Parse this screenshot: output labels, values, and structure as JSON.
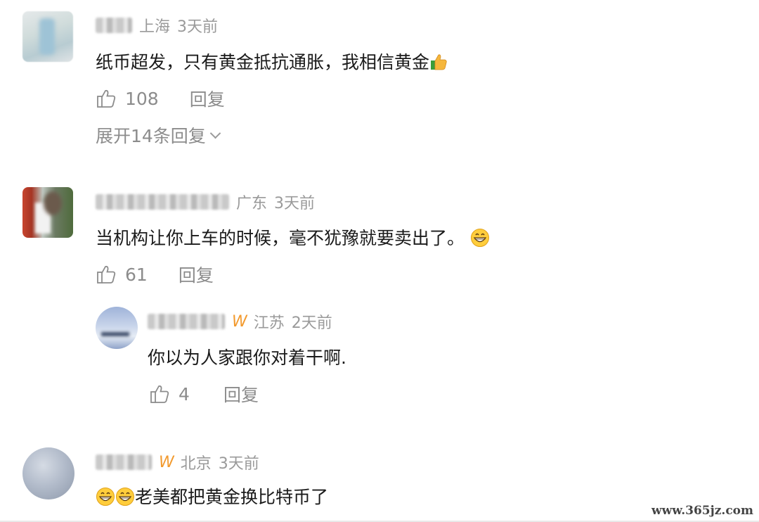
{
  "comments": [
    {
      "location": "上海",
      "time": "3天前",
      "text": "纸币超发，只有黄金抵抗通胀，我相信黄金",
      "likes": "108",
      "reply_label": "回复",
      "expand_label": "展开14条回复"
    },
    {
      "location": "广东",
      "time": "3天前",
      "text": "当机构让你上车的时候，毫不犹豫就要卖出了。",
      "likes": "61",
      "reply_label": "回复",
      "reply": {
        "location": "江苏",
        "time": "2天前",
        "text": "你以为人家跟你对着干啊.",
        "likes": "4",
        "reply_label": "回复"
      }
    },
    {
      "location": "北京",
      "time": "3天前",
      "text": "老美都把黄金换比特币了"
    }
  ],
  "watermark": "www.365jz.com",
  "icons": {
    "like": "thumbs-up-outline-icon",
    "vip": "vip-badge-icon",
    "thumb_emoji": "thumbs-up-emoji",
    "grin_emoji": "grinning-emoji"
  },
  "colors": {
    "vip": "#f29a2e",
    "muted": "#8c8c8c",
    "text": "#1a1a1a"
  }
}
